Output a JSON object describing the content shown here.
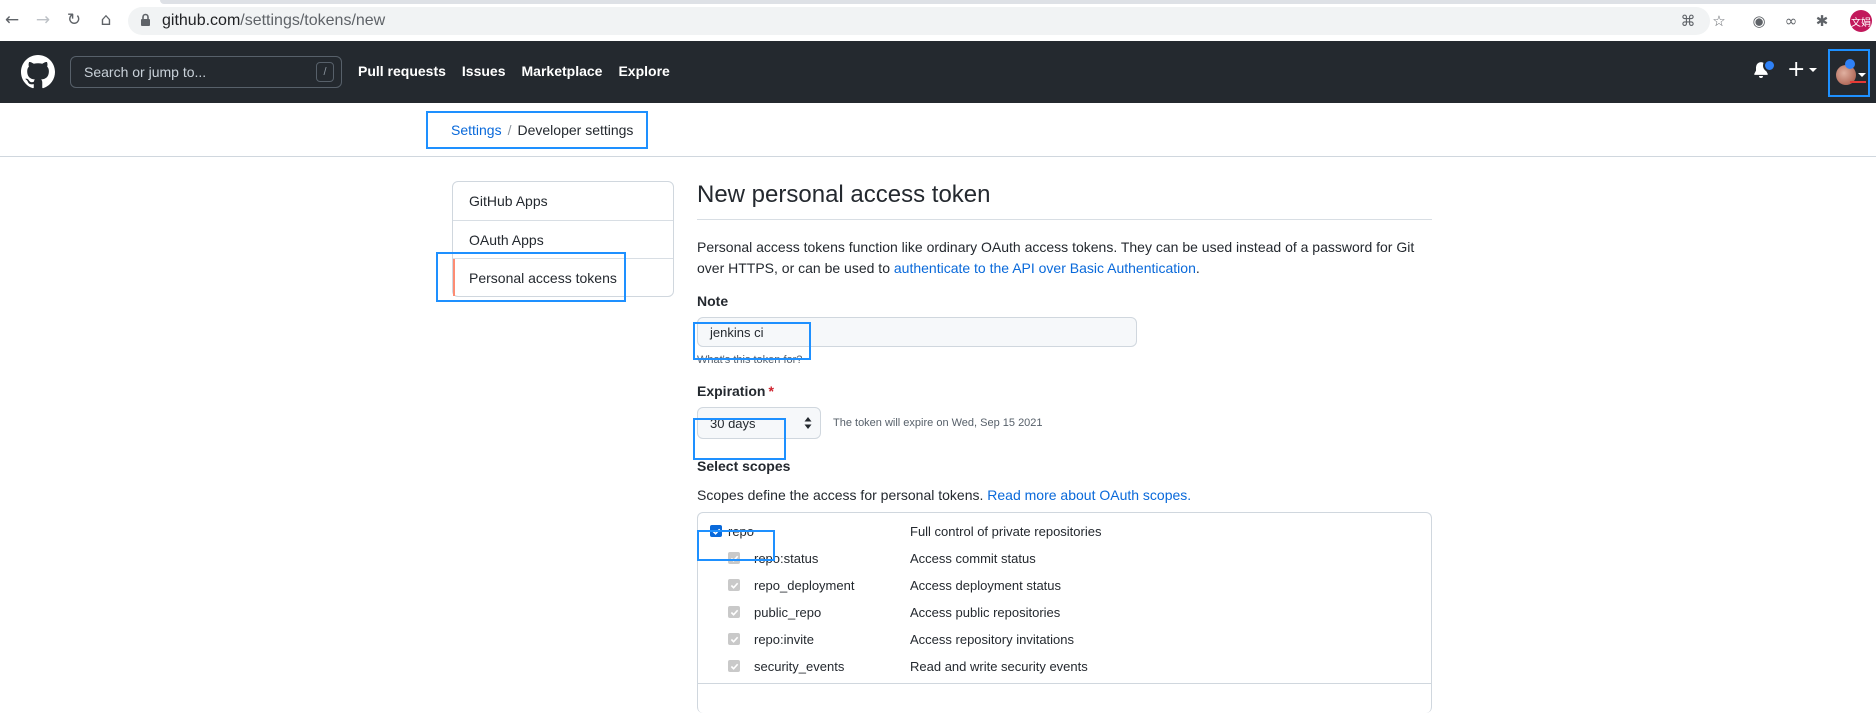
{
  "browser": {
    "url_domain": "github.com",
    "url_path": "/settings/tokens/new",
    "profile_initials": "文娟"
  },
  "header": {
    "search_placeholder": "Search or jump to...",
    "search_shortcut": "/",
    "nav": [
      "Pull requests",
      "Issues",
      "Marketplace",
      "Explore"
    ]
  },
  "breadcrumb": {
    "settings": "Settings",
    "separator": "/",
    "current": "Developer settings"
  },
  "sidebar": {
    "items": [
      "GitHub Apps",
      "OAuth Apps",
      "Personal access tokens"
    ],
    "active_index": 2
  },
  "main": {
    "title": "New personal access token",
    "intro_text": "Personal access tokens function like ordinary OAuth access tokens. They can be used instead of a password for Git over HTTPS, or can be used to ",
    "intro_link": "authenticate to the API over Basic Authentication",
    "intro_end": ".",
    "note_label": "Note",
    "note_value": "jenkins ci",
    "note_hint": "What's this token for?",
    "expiration_label": "Expiration",
    "expiration_required": "*",
    "expiration_value": "30 days",
    "expiration_note": "The token will expire on Wed, Sep 15 2021",
    "scopes_label": "Select scopes",
    "scopes_desc": "Scopes define the access for personal tokens. ",
    "scopes_link": "Read more about OAuth scopes.",
    "scopes": [
      {
        "name": "repo",
        "desc": "Full control of private repositories",
        "checked": true,
        "level": 0
      },
      {
        "name": "repo:status",
        "desc": "Access commit status",
        "checked": true,
        "level": 1
      },
      {
        "name": "repo_deployment",
        "desc": "Access deployment status",
        "checked": true,
        "level": 1
      },
      {
        "name": "public_repo",
        "desc": "Access public repositories",
        "checked": true,
        "level": 1
      },
      {
        "name": "repo:invite",
        "desc": "Access repository invitations",
        "checked": true,
        "level": 1
      },
      {
        "name": "security_events",
        "desc": "Read and write security events",
        "checked": true,
        "level": 1
      }
    ]
  },
  "colors": {
    "header_bg": "#24292f",
    "link": "#0969da",
    "highlight": "#1e90ff",
    "active_marker": "#fd8c73"
  }
}
